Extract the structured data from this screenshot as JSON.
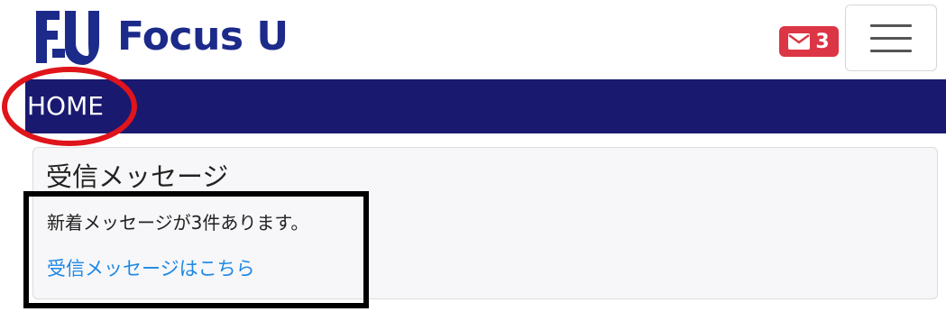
{
  "header": {
    "logo_text": "Focus U",
    "mail_count": "3",
    "icons": {
      "logo": "focus-u-logo-icon",
      "mail": "envelope-icon",
      "menu": "hamburger-icon"
    }
  },
  "nav": {
    "home_label": "HOME"
  },
  "inbox_card": {
    "title": "受信メッセージ",
    "message": "新着メッセージが3件あります。",
    "link_text": "受信メッセージはこちら"
  },
  "colors": {
    "brand": "#1c2a8a",
    "nav_band": "#191970",
    "badge": "#dc3545",
    "link": "#1e88e5",
    "annotation_red": "#e0141b"
  }
}
